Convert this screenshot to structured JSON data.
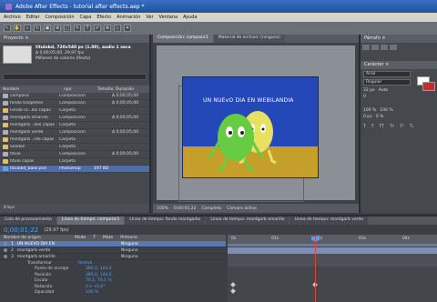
{
  "window": {
    "title": "Adobe After Effects - tutorial after effects.aep *"
  },
  "menu": [
    "Archivo",
    "Editar",
    "Composición",
    "Capa",
    "Efecto",
    "Animación",
    "Ver",
    "Ventana",
    "Ayuda"
  ],
  "project": {
    "tab": "Proyecto ×",
    "selected_name": "titulobd, 720x540 px (1.00), audio 1 seca",
    "selected_info1": "Δ 0;00;05;00, 29,97 fps",
    "selected_info2": "Millones de colores (Recto)",
    "columns": [
      "Nombre",
      "Tipo",
      "Tamaño",
      "Duración"
    ],
    "items": [
      {
        "name": "composic",
        "type": "Composición",
        "size": "",
        "dur": "Δ 0;00;05;00",
        "color": "#b0b0b0",
        "sel": false
      },
      {
        "name": "fondo tosqemes",
        "type": "Composición",
        "size": "",
        "dur": "Δ 0;00;05;00",
        "color": "#b0b0b0",
        "sel": false
      },
      {
        "name": "Fondo ro...los capas",
        "type": "Carpeta",
        "size": "",
        "dur": "",
        "color": "#e0c060",
        "sel": false
      },
      {
        "name": "montgarb amarillo",
        "type": "Composición",
        "size": "",
        "dur": "Δ 0;00;05;00",
        "color": "#b0b0b0",
        "sel": false
      },
      {
        "name": "montgarb ..ello capas",
        "type": "Carpeta",
        "size": "",
        "dur": "",
        "color": "#e0c060",
        "sel": false
      },
      {
        "name": "montgarb verde",
        "type": "Composición",
        "size": "",
        "dur": "Δ 0;00;05;00",
        "color": "#b0b0b0",
        "sel": false
      },
      {
        "name": "montgarb ..rde capas",
        "type": "Carpeta",
        "size": "",
        "dur": "",
        "color": "#e0c060",
        "sel": false
      },
      {
        "name": "Sólidos",
        "type": "Carpeta",
        "size": "",
        "dur": "",
        "color": "#e0c060",
        "sel": false
      },
      {
        "name": "titulo",
        "type": "Composición",
        "size": "",
        "dur": "Δ 0;00;05;00",
        "color": "#b0b0b0",
        "sel": false
      },
      {
        "name": "titulo capas",
        "type": "Carpeta",
        "size": "",
        "dur": "",
        "color": "#e0c060",
        "sel": false
      },
      {
        "name": "titulobd_base.psd",
        "type": "Photoshop",
        "size": "197 KB",
        "dur": "",
        "color": "#6aa0d8",
        "sel": true
      }
    ],
    "footer": "8 bpc"
  },
  "viewer": {
    "tabs": [
      "Composición: composic1",
      "Material de archivo: (ninguno)"
    ],
    "headline": "UN NUEvO DIA EN  WEBILANDIA",
    "zoom": "100%",
    "timecode": "0;00;01;22",
    "resolution": "Completa",
    "camera": "Cámara activa"
  },
  "right_panel": {
    "title": "Párrafo ×",
    "char_title": "Carácter ×",
    "font": "Arial",
    "style": "Regular",
    "size1": "32 px",
    "size2": "Auto",
    "tracking": "0",
    "scale_v": "100 %",
    "scale_h": "100 %",
    "baseline": "0 px",
    "tsume": "0 %"
  },
  "timeline": {
    "tabs": [
      "Cola de procesamiento",
      "Línea de tiempo: composic1",
      "Línea de tiempo: fondo montgarbs",
      "Línea de tiempo: montgarb amarillo",
      "Línea de tiempo: montgarb verde"
    ],
    "timecode": "0;00;01;22",
    "fps": "(29,97 fps)",
    "columns": [
      "Nombre de origen",
      "Modo",
      "T",
      "Mate",
      "Primario"
    ],
    "layers": [
      {
        "num": "1",
        "name": "UN NUEVO DIA EN",
        "parent": "Ninguno",
        "sel": true
      },
      {
        "num": "2",
        "name": "montgarb verde",
        "parent": "Ninguno",
        "sel": false
      },
      {
        "num": "3",
        "name": "montgarb amarillo",
        "parent": "Ninguno",
        "sel": false
      }
    ],
    "transform_label": "Transformar",
    "reset": "Restab.",
    "props": [
      {
        "name": "Punto de anclaje",
        "value": "380,0, 144,0"
      },
      {
        "name": "Posición",
        "value": "380,0, 144,0"
      },
      {
        "name": "Escala",
        "value": "70,1, 70,1 %"
      },
      {
        "name": "Rotación",
        "value": "0 x +0,0°"
      },
      {
        "name": "Opacidad",
        "value": "100 %"
      }
    ],
    "ruler": [
      "0s",
      "01s",
      "02s",
      "03s",
      "04s"
    ]
  }
}
